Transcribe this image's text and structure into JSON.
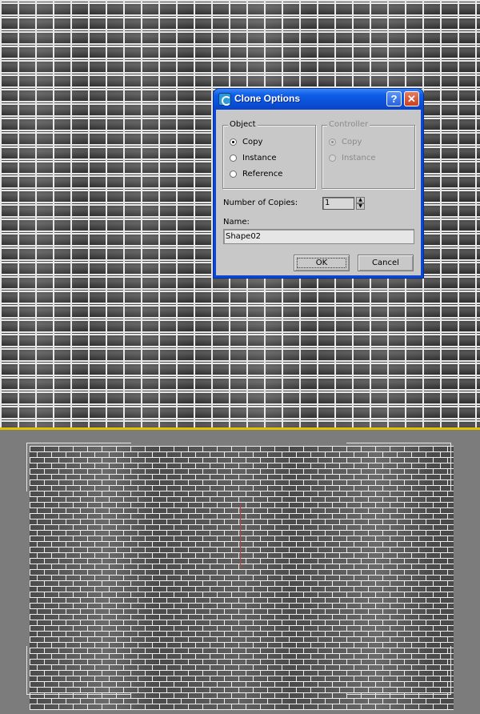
{
  "colors": {
    "titlebar": "#0b4fd8",
    "dialog_face": "#c8c8c8",
    "viewport_active_border": "#e0c000",
    "selection_axis": "#c04040"
  },
  "dialog": {
    "title": "Clone Options",
    "icon": "3ds-max-app-icon",
    "help_label": "?",
    "close_label": "✕",
    "object_group": {
      "legend": "Object",
      "options": [
        {
          "label": "Copy",
          "checked": true
        },
        {
          "label": "Instance",
          "checked": false
        },
        {
          "label": "Reference",
          "checked": false
        }
      ]
    },
    "controller_group": {
      "legend": "Controller",
      "disabled": true,
      "options": [
        {
          "label": "Copy",
          "checked": true
        },
        {
          "label": "Instance",
          "checked": false
        }
      ]
    },
    "copies": {
      "label": "Number of Copies:",
      "value": "1"
    },
    "name": {
      "label": "Name:",
      "value": "Shape02"
    },
    "ok_label": "OK",
    "cancel_label": "Cancel"
  }
}
